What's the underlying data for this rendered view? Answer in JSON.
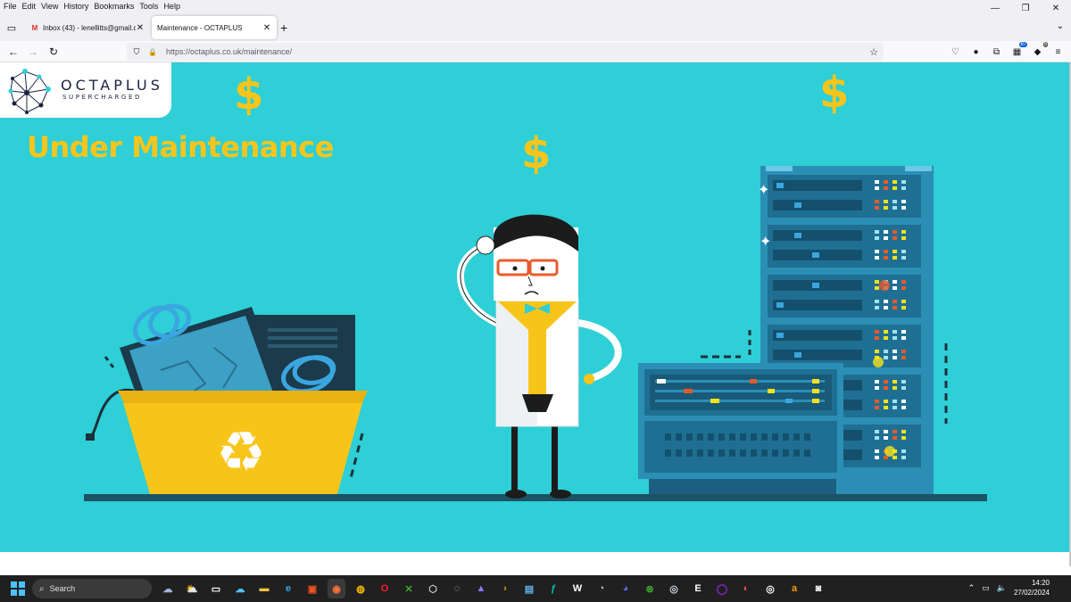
{
  "menu": [
    "File",
    "Edit",
    "View",
    "History",
    "Bookmarks",
    "Tools",
    "Help"
  ],
  "window_controls": {
    "minimize": "—",
    "restore": "❐",
    "close": "✕"
  },
  "tabs": [
    {
      "favicon": "M",
      "title": "Inbox (43) - lenellitts@gmail.co",
      "close": "✕"
    },
    {
      "favicon": "",
      "title": "Maintenance - OCTAPLUS",
      "close": "✕"
    }
  ],
  "new_tab": "+",
  "tabs_overflow": "⌄",
  "nav": {
    "back": "←",
    "forward": "→",
    "reload": "↻",
    "url": "https://octaplus.co.uk/maintenance/",
    "shield": "⛉",
    "lock": "🔒",
    "star": "☆"
  },
  "toolbar_icons": [
    {
      "name": "pocket-icon",
      "glyph": "♡"
    },
    {
      "name": "account-icon",
      "glyph": "●"
    },
    {
      "name": "extensions-icon",
      "glyph": "⧉"
    },
    {
      "name": "extension-badge-icon",
      "glyph": "▦",
      "badge": "87"
    },
    {
      "name": "extension-red-icon",
      "glyph": "◆",
      "badge": "5"
    },
    {
      "name": "menu-icon",
      "glyph": "≡"
    }
  ],
  "page": {
    "logo_name": "OCTAPLUS",
    "logo_tagline": "SUPERCHARGED",
    "heading": "Under Maintenance",
    "dollar": "$",
    "recycle_symbol": "♻",
    "colors": {
      "background": "#2ecfd6",
      "accent": "#f7c51a",
      "server": "#2b8fb5",
      "server_dark": "#1c5f80",
      "bin": "#f7c51a"
    }
  },
  "taskbar": {
    "search_label": "Search",
    "apps": [
      {
        "name": "cloud-widget-icon",
        "glyph": "☁",
        "color": "#9fb7d8"
      },
      {
        "name": "weather-icon",
        "glyph": "⛅",
        "color": "#4aa3ff"
      },
      {
        "name": "taskview-icon",
        "glyph": "▭",
        "color": "#ffffff"
      },
      {
        "name": "onedrive-icon",
        "glyph": "☁",
        "color": "#4cc2ff"
      },
      {
        "name": "explorer-icon",
        "glyph": "▬",
        "color": "#f5c542"
      },
      {
        "name": "edge-icon",
        "glyph": "e",
        "color": "#36a8e0"
      },
      {
        "name": "store-icon",
        "glyph": "▣",
        "color": "#f25022"
      },
      {
        "name": "firefox-icon",
        "glyph": "◉",
        "color": "#ff7139",
        "active": true
      },
      {
        "name": "chrome-icon",
        "glyph": "◍",
        "color": "#fbbc04"
      },
      {
        "name": "opera-icon",
        "glyph": "O",
        "color": "#ff1b2d"
      },
      {
        "name": "xbox-app-icon",
        "glyph": "✕",
        "color": "#3eaa2d"
      },
      {
        "name": "unity-icon",
        "glyph": "⬡",
        "color": "#cccccc"
      },
      {
        "name": "app-icon-1",
        "glyph": "◌",
        "color": "#cccccc"
      },
      {
        "name": "proton-icon",
        "glyph": "▲",
        "color": "#8a7cff"
      },
      {
        "name": "plex-icon",
        "glyph": "›",
        "color": "#e5a00d"
      },
      {
        "name": "photos-icon",
        "glyph": "▤",
        "color": "#63b3ed"
      },
      {
        "name": "app-icon-2",
        "glyph": "ƒ",
        "color": "#00c2b8"
      },
      {
        "name": "wordpress-icon",
        "glyph": "W",
        "color": "#ffffff"
      },
      {
        "name": "app-icon-3",
        "glyph": "◔",
        "color": "#cccccc"
      },
      {
        "name": "discord-icon",
        "glyph": "◕",
        "color": "#5865f2"
      },
      {
        "name": "xbox-icon",
        "glyph": "⊗",
        "color": "#3eaa2d"
      },
      {
        "name": "steam-icon",
        "glyph": "◎",
        "color": "#c7d5e0"
      },
      {
        "name": "epic-icon",
        "glyph": "E",
        "color": "#ffffff"
      },
      {
        "name": "app-icon-4",
        "glyph": "◯",
        "color": "#a020f0"
      },
      {
        "name": "ea-icon",
        "glyph": "◐",
        "color": "#ff4747"
      },
      {
        "name": "app-icon-5",
        "glyph": "◎",
        "color": "#ffffff"
      },
      {
        "name": "amazon-icon",
        "glyph": "a",
        "color": "#ff9900"
      },
      {
        "name": "app-icon-6",
        "glyph": "◙",
        "color": "#ffffff"
      }
    ],
    "tray": {
      "chevron": "⌃",
      "display": "▭",
      "volume": "🔈"
    },
    "time": "14:20",
    "date": "27/02/2024"
  }
}
